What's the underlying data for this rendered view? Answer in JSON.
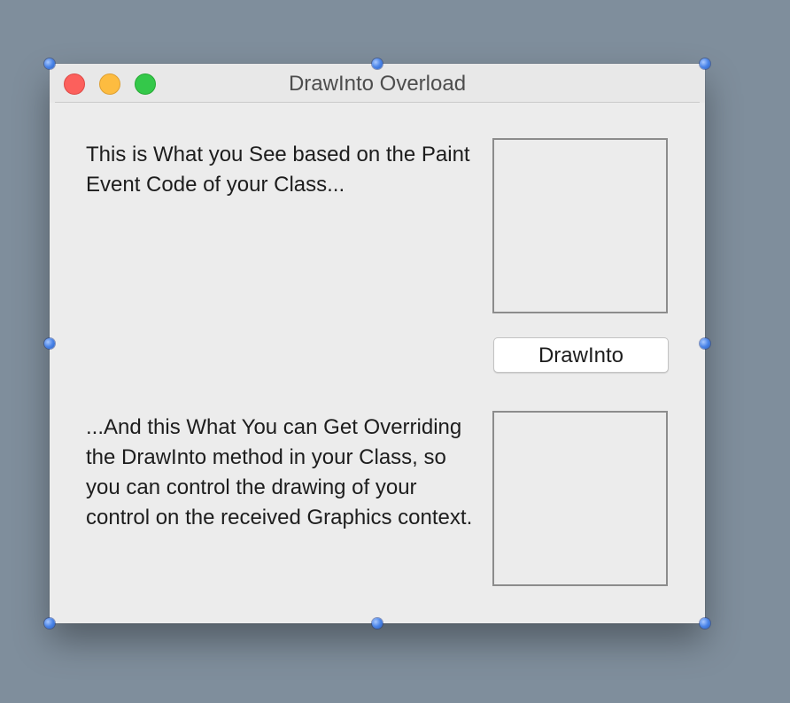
{
  "window": {
    "title": "DrawInto Overload"
  },
  "content": {
    "top_text": "This is What you See based on the Paint Event Code of your Class...",
    "bottom_text": "...And this What You can Get Overriding the DrawInto method in your Class, so you can control the drawing of your control on the received Graphics context.",
    "button_label": "DrawInto"
  },
  "colors": {
    "close": "#fc605c",
    "minimize": "#fdbc40",
    "zoom": "#34c84a",
    "selection_handle": "#4a84e8"
  },
  "icons": {
    "close": "close-icon",
    "minimize": "minimize-icon",
    "zoom": "zoom-icon",
    "handle": "resize-handle-icon"
  }
}
